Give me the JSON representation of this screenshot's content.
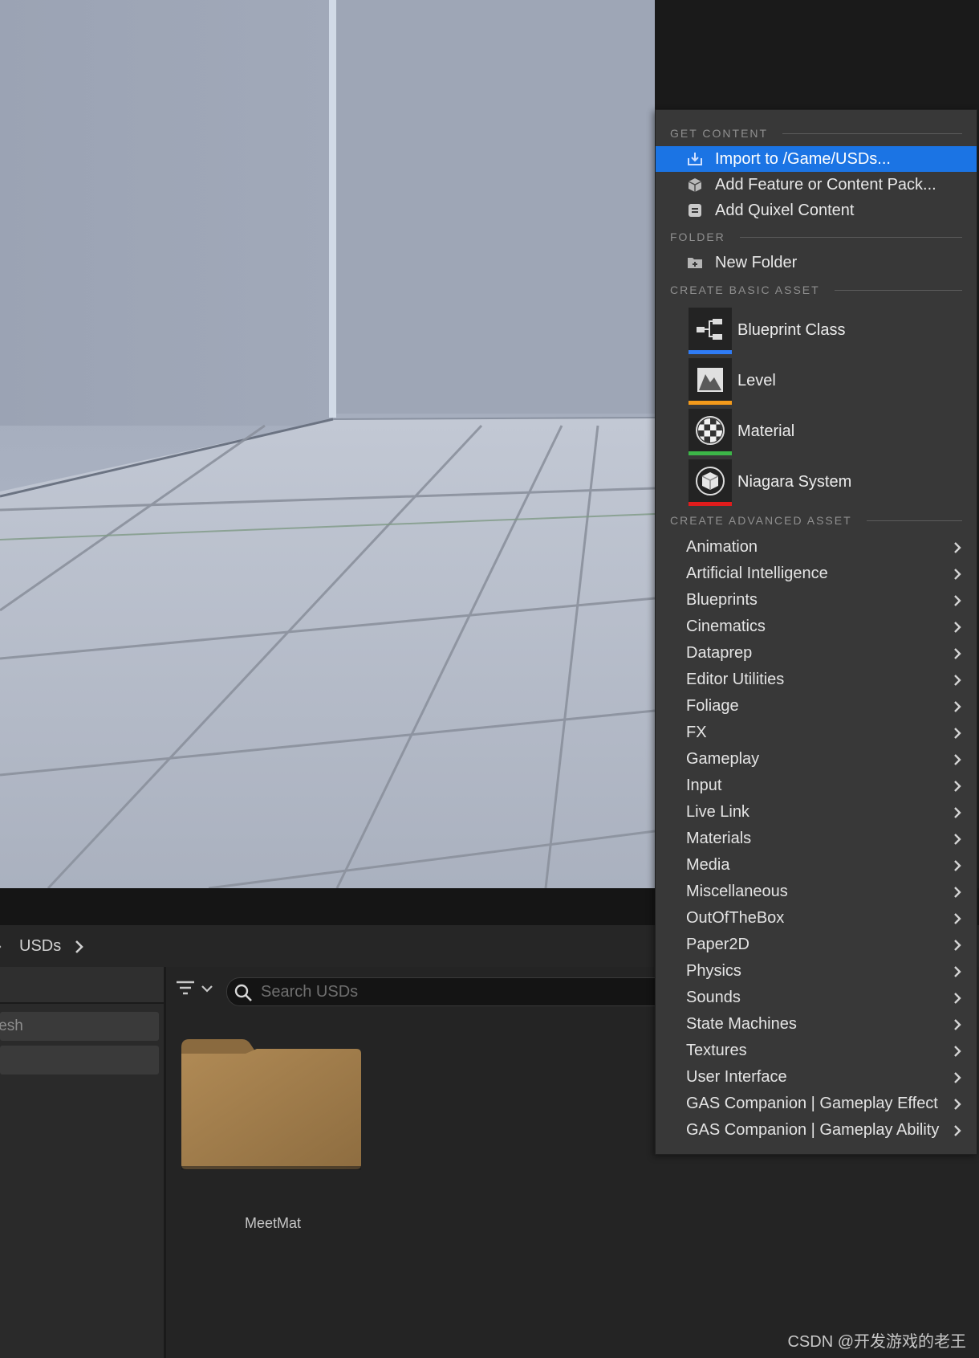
{
  "breadcrumb": {
    "current": "USDs"
  },
  "search": {
    "placeholder": "Search USDs"
  },
  "left_panel": {
    "field1_text": "lesh"
  },
  "content": {
    "folder_name": "MeetMat"
  },
  "watermark": "CSDN @开发游戏的老王",
  "menu": {
    "sections": {
      "get_content": "GET CONTENT",
      "folder": "FOLDER",
      "create_basic": "CREATE BASIC ASSET",
      "create_advanced": "CREATE ADVANCED ASSET"
    },
    "get_content_items": [
      {
        "label": "Import to /Game/USDs...",
        "icon": "import-icon",
        "highlighted": true
      },
      {
        "label": "Add Feature or Content Pack...",
        "icon": "content-pack-icon"
      },
      {
        "label": "Add Quixel Content",
        "icon": "quixel-icon"
      }
    ],
    "folder_items": [
      {
        "label": "New Folder",
        "icon": "new-folder-icon"
      }
    ],
    "basic_assets": [
      {
        "label": "Blueprint Class",
        "icon": "blueprint-class-icon",
        "color": "#2f7cf6"
      },
      {
        "label": "Level",
        "icon": "level-icon",
        "color": "#f39a1b"
      },
      {
        "label": "Material",
        "icon": "material-icon",
        "color": "#3cb648"
      },
      {
        "label": "Niagara System",
        "icon": "niagara-system-icon",
        "color": "#e01c1c"
      }
    ],
    "advanced_assets": [
      "Animation",
      "Artificial Intelligence",
      "Blueprints",
      "Cinematics",
      "Dataprep",
      "Editor Utilities",
      "Foliage",
      "FX",
      "Gameplay",
      "Input",
      "Live Link",
      "Materials",
      "Media",
      "Miscellaneous",
      "OutOfTheBox",
      "Paper2D",
      "Physics",
      "Sounds",
      "State Machines",
      "Textures",
      "User Interface",
      "GAS Companion | Gameplay Effect",
      "GAS Companion | Gameplay Ability"
    ],
    "highlight_color": "#1b74e4"
  }
}
